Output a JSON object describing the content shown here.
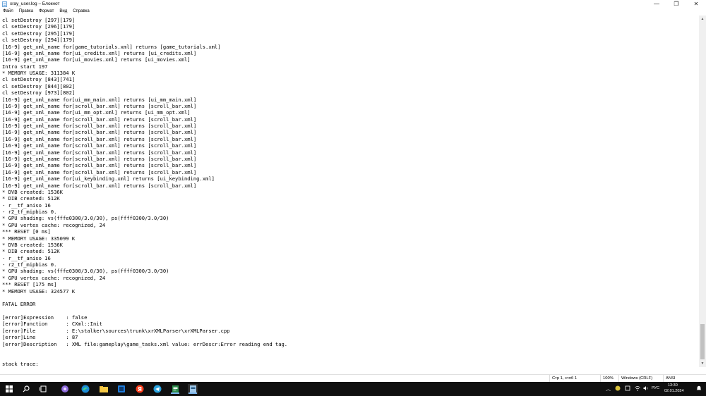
{
  "window": {
    "title": "xray_user.log – Блокнот",
    "minimize_glyph": "—",
    "maximize_glyph": "❐",
    "close_glyph": "✕"
  },
  "menu": [
    {
      "label": "Файл"
    },
    {
      "label": "Правка"
    },
    {
      "label": "Формат"
    },
    {
      "label": "Вид"
    },
    {
      "label": "Справка"
    }
  ],
  "editor": {
    "lines": [
      "cl setDestroy [297][179]",
      "cl setDestroy [296][179]",
      "cl setDestroy [295][179]",
      "cl setDestroy [294][179]",
      "[16-9] get_xml_name for[game_tutorials.xml] returns [game_tutorials.xml]",
      "[16-9] get_xml_name for[ui_credits.xml] returns [ui_credits.xml]",
      "[16-9] get_xml_name for[ui_movies.xml] returns [ui_movies.xml]",
      "Intro start 197",
      "* MEMORY USAGE: 311384 K",
      "cl setDestroy [843][741]",
      "cl setDestroy [844][802]",
      "cl setDestroy [973][802]",
      "[16-9] get_xml_name for[ui_mm_main.xml] returns [ui_mm_main.xml]",
      "[16-9] get_xml_name for[scroll_bar.xml] returns [scroll_bar.xml]",
      "[16-9] get_xml_name for[ui_mm_opt.xml] returns [ui_mm_opt.xml]",
      "[16-9] get_xml_name for[scroll_bar.xml] returns [scroll_bar.xml]",
      "[16-9] get_xml_name for[scroll_bar.xml] returns [scroll_bar.xml]",
      "[16-9] get_xml_name for[scroll_bar.xml] returns [scroll_bar.xml]",
      "[16-9] get_xml_name for[scroll_bar.xml] returns [scroll_bar.xml]",
      "[16-9] get_xml_name for[scroll_bar.xml] returns [scroll_bar.xml]",
      "[16-9] get_xml_name for[scroll_bar.xml] returns [scroll_bar.xml]",
      "[16-9] get_xml_name for[scroll_bar.xml] returns [scroll_bar.xml]",
      "[16-9] get_xml_name for[scroll_bar.xml] returns [scroll_bar.xml]",
      "[16-9] get_xml_name for[scroll_bar.xml] returns [scroll_bar.xml]",
      "[16-9] get_xml_name for[ui_keybinding.xml] returns [ui_keybinding.xml]",
      "[16-9] get_xml_name for[scroll_bar.xml] returns [scroll_bar.xml]",
      "* DVB created: 1536K",
      "* DIB created: 512K",
      "- r__tf_aniso 16",
      "- r2_tf_mipbias 0.",
      "* GPU shading: vs(fffe0300/3.0/30), ps(ffff0300/3.0/30)",
      "* GPU vertex cache: recognized, 24",
      "*** RESET [0 ms]",
      "* MEMORY USAGE: 335099 K",
      "* DVB created: 1536K",
      "* DIB created: 512K",
      "- r__tf_aniso 16",
      "- r2_tf_mipbias 0.",
      "* GPU shading: vs(fffe0300/3.0/30), ps(ffff0300/3.0/30)",
      "* GPU vertex cache: recognized, 24",
      "*** RESET [175 ms]",
      "* MEMORY USAGE: 324577 K",
      "",
      "FATAL ERROR",
      "",
      "[error]Expression    : false",
      "[error]Function      : CXml::Init",
      "[error]File          : E:\\stalker\\sources\\trunk\\xrXMLParser\\xrXMLParser.cpp",
      "[error]Line          : 87",
      "[error]Description   : XML file:gameplay\\game_tasks.xml value: errDescr:Error reading end tag.",
      "",
      "",
      "stack trace:"
    ]
  },
  "statusbar": {
    "position": "Стр 1, стлб 1",
    "zoom": "100%",
    "line_ending": "Windows (CRLF)",
    "encoding": "ANSI"
  },
  "taskbar": {
    "icons": [
      "windows-start-icon",
      "search-icon",
      "task-view-icon",
      "copilot-icon",
      "edge-icon",
      "file-explorer-icon",
      "app-icon",
      "yandex-icon",
      "telegram-icon",
      "notepad-icon",
      "notepad-icon"
    ],
    "language": "РУС",
    "time": "13:30",
    "date": "02.01.2024"
  }
}
